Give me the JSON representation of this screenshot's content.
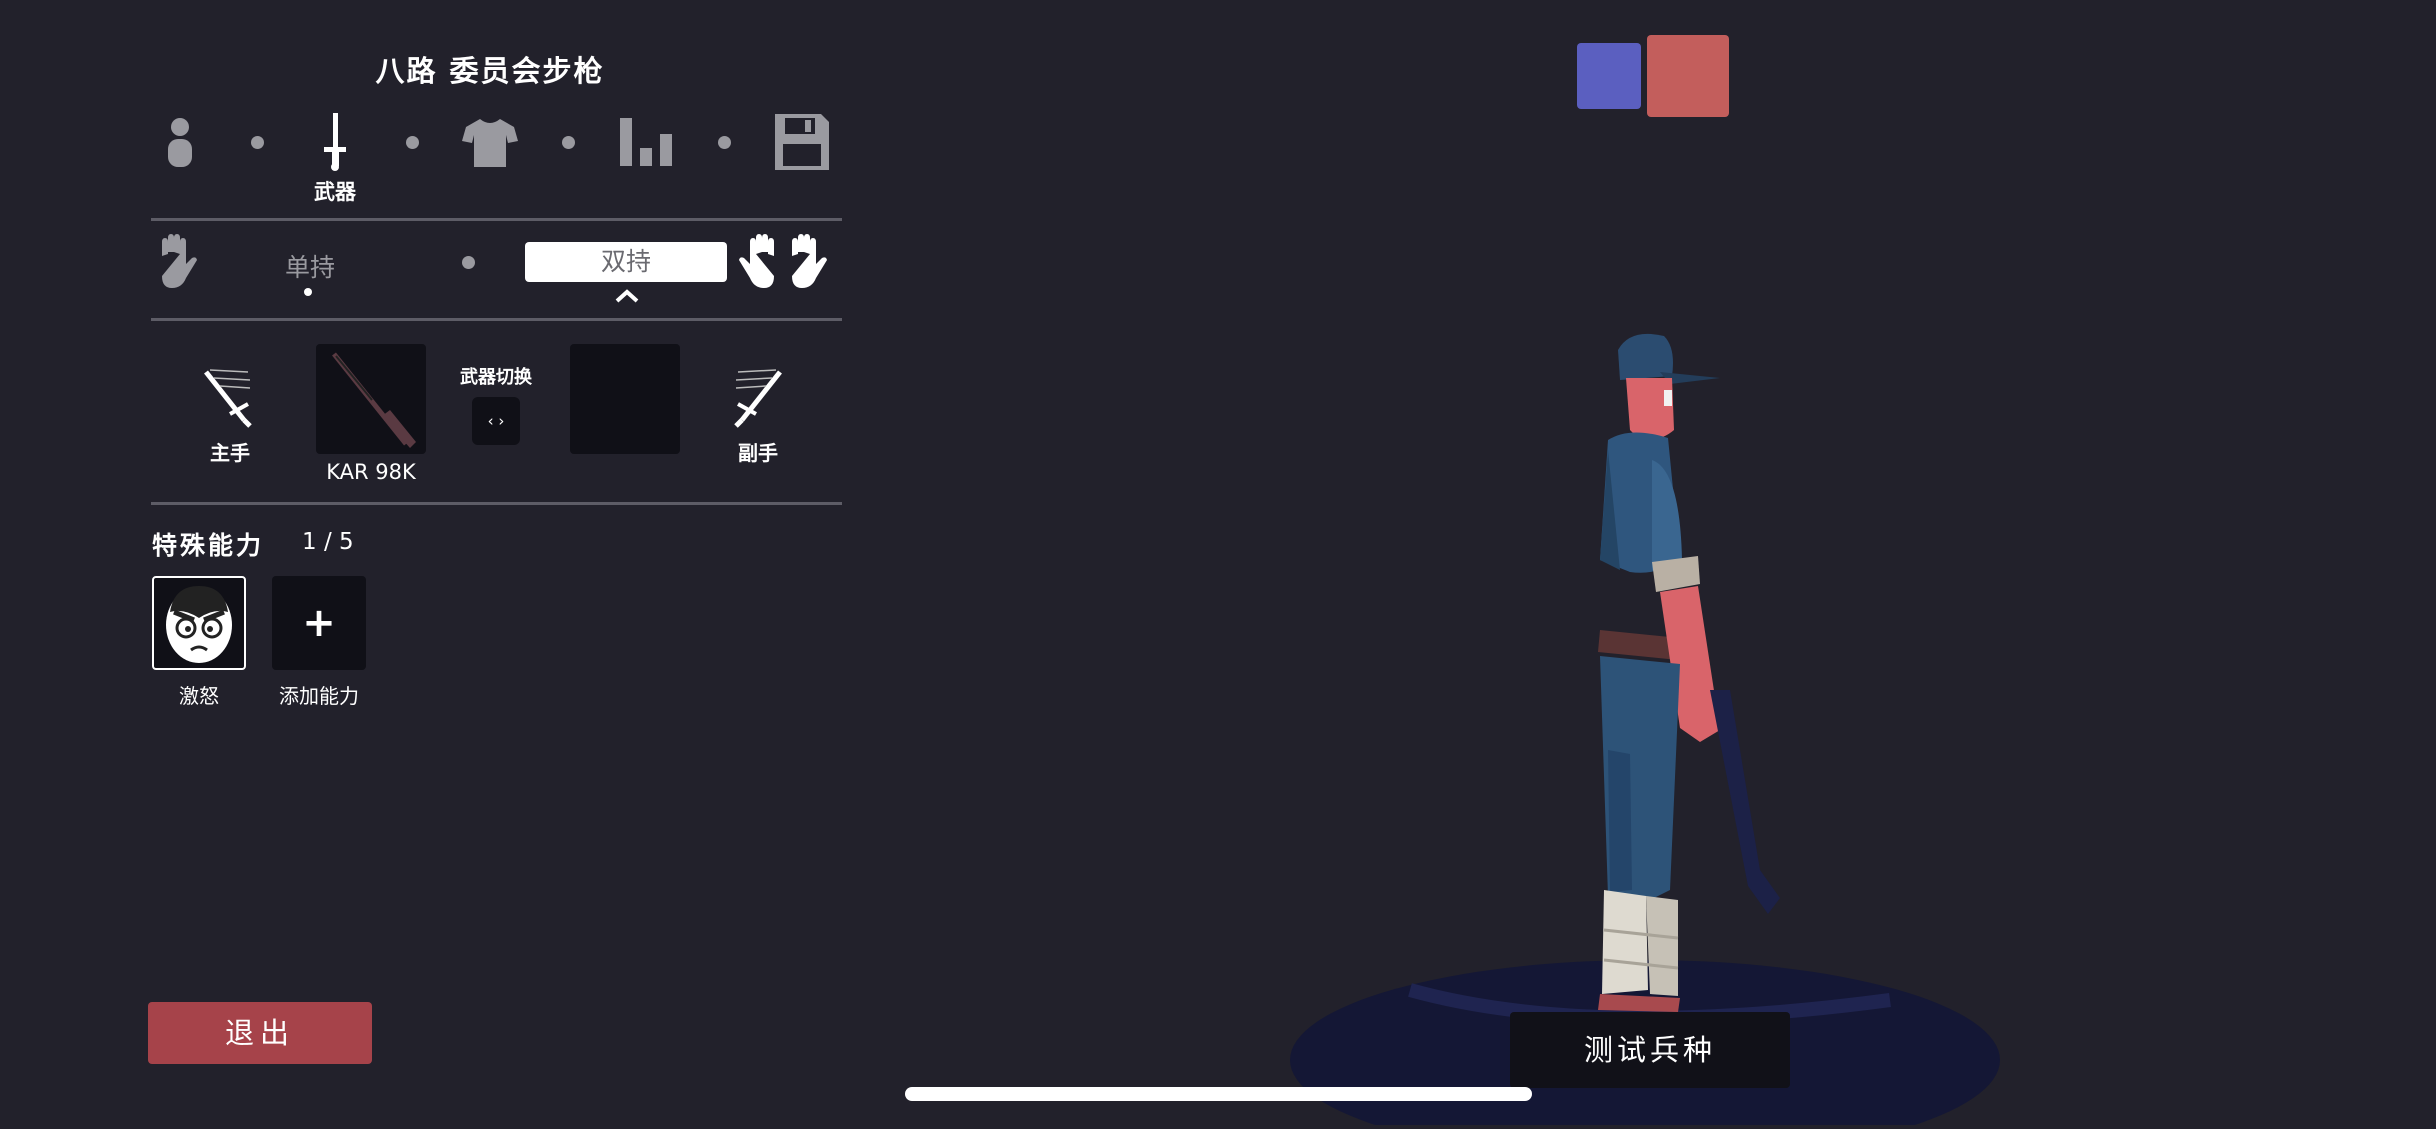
{
  "unit": {
    "title": "八路 委员会步枪"
  },
  "categories": [
    {
      "icon": "person-icon",
      "label": ""
    },
    {
      "icon": "sword-icon",
      "label": "武器"
    },
    {
      "icon": "shirt-icon",
      "label": ""
    },
    {
      "icon": "bar-chart-icon",
      "label": ""
    },
    {
      "icon": "save-disk-icon",
      "label": ""
    }
  ],
  "grip_mode": {
    "single_label": "单持",
    "dual_label": "双持",
    "selected": "双持"
  },
  "weapons": {
    "main_hand_label": "主手",
    "main_weapon_name": "KAR 98K",
    "switch_label": "武器切换",
    "switch_icon": "‹ ›",
    "off_hand_label": "副手"
  },
  "abilities": {
    "title": "特殊能力",
    "count": "1 / 5",
    "items": [
      {
        "label": "激怒",
        "icon": "angry-face-icon"
      },
      {
        "label": "添加能力",
        "icon": "+"
      }
    ]
  },
  "buttons": {
    "exit": "退出",
    "test": "测试兵种"
  },
  "team_colors": {
    "blue": "#5b5fc0",
    "red": "#c35e5c"
  },
  "colors": {
    "accent_red": "#a6434a",
    "background": "#22212b"
  }
}
